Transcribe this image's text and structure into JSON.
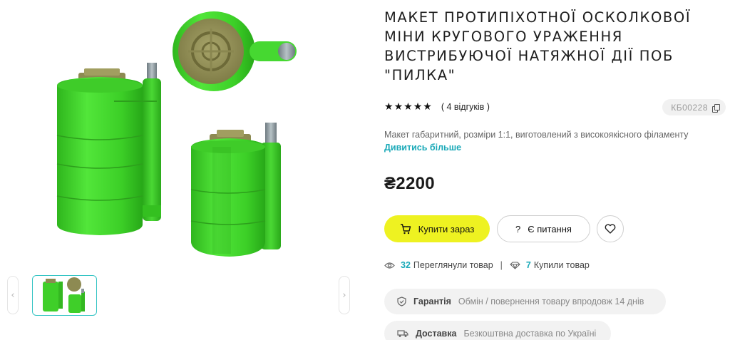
{
  "product": {
    "title": "МАКЕТ ПРОТИПІХОТНОЇ ОСКОЛКОВОЇ МІНИ КРУГОВОГО УРАЖЕННЯ ВИСТРИБУЮЧОЇ НАТЯЖНОЇ ДІЇ ПОБ \"ПИЛКА\"",
    "rating_stars": 5,
    "reviews": "( 4 відгуків )",
    "sku": "КБ00228",
    "description": "Макет габаритний, розміри 1:1, виготовлений з високоякісного філаменту",
    "more_link": "Дивитись більше",
    "price": "₴2200"
  },
  "actions": {
    "buy_now": "Купити зараз",
    "question": "Є питання"
  },
  "stats": {
    "views_count": "32",
    "views_label": "Переглянули товар",
    "separator": "|",
    "bought_count": "7",
    "bought_label": "Купили товар"
  },
  "info_pills": {
    "guarantee_key": "Гарантія",
    "guarantee_value": "Обмін / повернення товару впродовж 14 днів",
    "delivery_key": "Доставка",
    "delivery_value": "Безкоштвна доставка по Україні"
  },
  "gallery": {
    "prev_arrow": "‹",
    "next_arrow": "›"
  },
  "icons": {
    "cart": "cart-icon",
    "question": "question-icon",
    "heart": "heart-icon",
    "eye": "eye-icon",
    "diamond": "diamond-icon",
    "shield": "shield-icon",
    "truck": "truck-icon",
    "copy": "copy-icon",
    "star": "star-icon"
  },
  "colors": {
    "accent_yellow": "#eef221",
    "link_teal": "#1aa9b8",
    "model_green": "#3ed428",
    "model_olive": "#8d8a52",
    "pill_bg": "#f2f2f2"
  }
}
